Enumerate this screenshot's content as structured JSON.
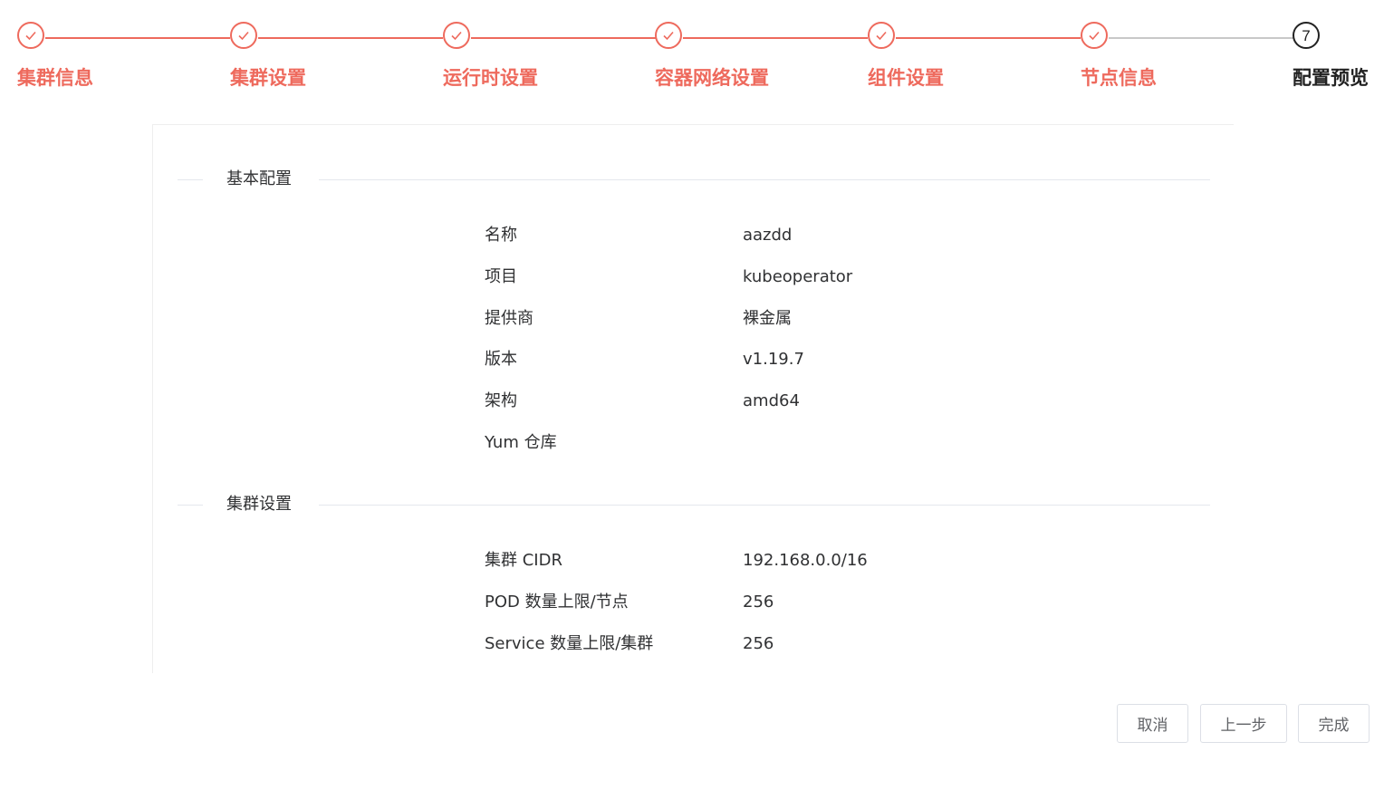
{
  "steps": [
    {
      "label": "集群信息",
      "status": "done"
    },
    {
      "label": "集群设置",
      "status": "done"
    },
    {
      "label": "运行时设置",
      "status": "done"
    },
    {
      "label": "容器网络设置",
      "status": "done"
    },
    {
      "label": "组件设置",
      "status": "done"
    },
    {
      "label": "节点信息",
      "status": "done"
    },
    {
      "label": "配置预览",
      "status": "active",
      "number": "7"
    }
  ],
  "colors": {
    "accent": "#ee6a5d",
    "active": "#222222",
    "pending_line": "#c8c8c8"
  },
  "sections": {
    "basic": {
      "title": "基本配置",
      "rows": [
        {
          "key": "名称",
          "value": "aazdd"
        },
        {
          "key": "项目",
          "value": "kubeoperator"
        },
        {
          "key": "提供商",
          "value": "裸金属"
        },
        {
          "key": "版本",
          "value": "v1.19.7"
        },
        {
          "key": "架构",
          "value": "amd64"
        },
        {
          "key": "Yum 仓库",
          "value": ""
        }
      ]
    },
    "cluster": {
      "title": "集群设置",
      "rows": [
        {
          "key": "集群 CIDR",
          "value": "192.168.0.0/16"
        },
        {
          "key": "POD 数量上限/节点",
          "value": "256"
        },
        {
          "key": "Service 数量上限/集群",
          "value": "256"
        }
      ]
    }
  },
  "footer": {
    "cancel_label": "取消",
    "prev_label": "上一步",
    "finish_label": "完成"
  }
}
